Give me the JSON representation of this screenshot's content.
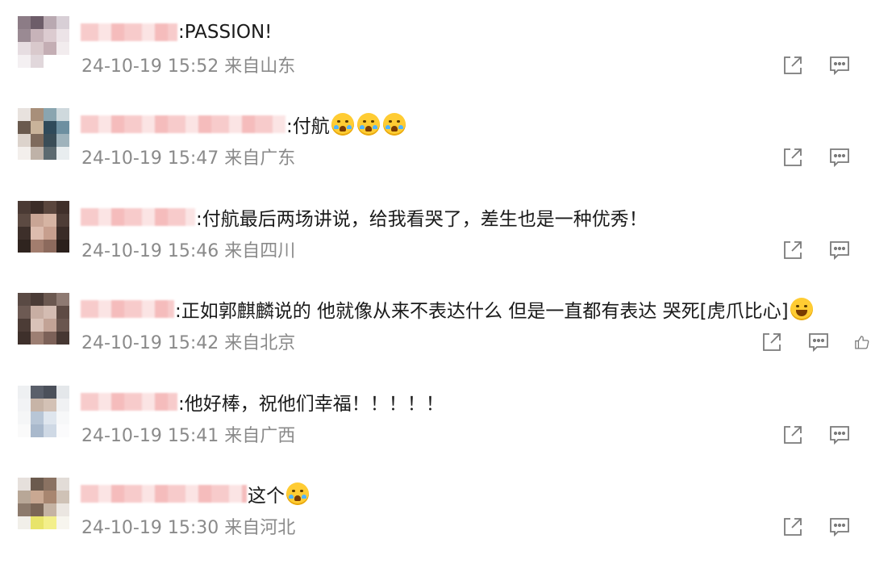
{
  "comments": [
    {
      "text": ":PASSION!",
      "time": "24-10-19 15:52",
      "location": "来自山东"
    },
    {
      "text": ":付航",
      "time": "24-10-19 15:47",
      "location": "来自广东"
    },
    {
      "text": ":付航最后两场讲说，给我看哭了，差生也是一种优秀！",
      "time": "24-10-19 15:46",
      "location": "来自四川"
    },
    {
      "text": ":正如郭麒麟说的 他就像从来不表达什么 但是一直都有表达 哭死[虎爪比心]",
      "time": "24-10-19 15:42",
      "location": "来自北京"
    },
    {
      "text": ":他好棒，祝他们幸福！！！！！",
      "time": "24-10-19 15:41",
      "location": "来自广西"
    },
    {
      "text": "这个",
      "time": "24-10-19 15:30",
      "location": "来自河北"
    }
  ],
  "icons": {
    "share": "share-icon",
    "comment": "comment-icon",
    "like": "like-icon"
  },
  "colors": {
    "text": "#1a1a1a",
    "meta": "#8a8a8a",
    "icon": "#7a7a7a",
    "emoji": "#ffcc33"
  }
}
